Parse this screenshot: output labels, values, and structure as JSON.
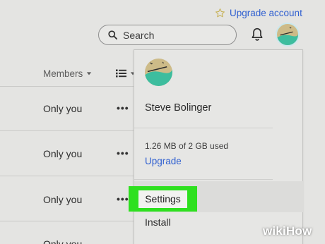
{
  "header": {
    "upgrade_label": "Upgrade account",
    "search_placeholder": "Search"
  },
  "table": {
    "members_header": "Members",
    "rows": [
      {
        "sharing": "Only you"
      },
      {
        "sharing": "Only you"
      },
      {
        "sharing": "Only you"
      },
      {
        "sharing": "Only you"
      }
    ],
    "more_label": "•••"
  },
  "account_menu": {
    "user_name": "Steve Bolinger",
    "storage_usage": "1.26 MB of 2 GB used",
    "upgrade_label": "Upgrade",
    "settings_label": "Settings",
    "install_label": "Install"
  },
  "watermark": {
    "wiki": "wiki",
    "how": "How"
  },
  "colors": {
    "background": "#e4e4e2",
    "link": "#2f5fd0",
    "highlight": "#2ee01f",
    "avatar_teal": "#3dbd9e"
  }
}
